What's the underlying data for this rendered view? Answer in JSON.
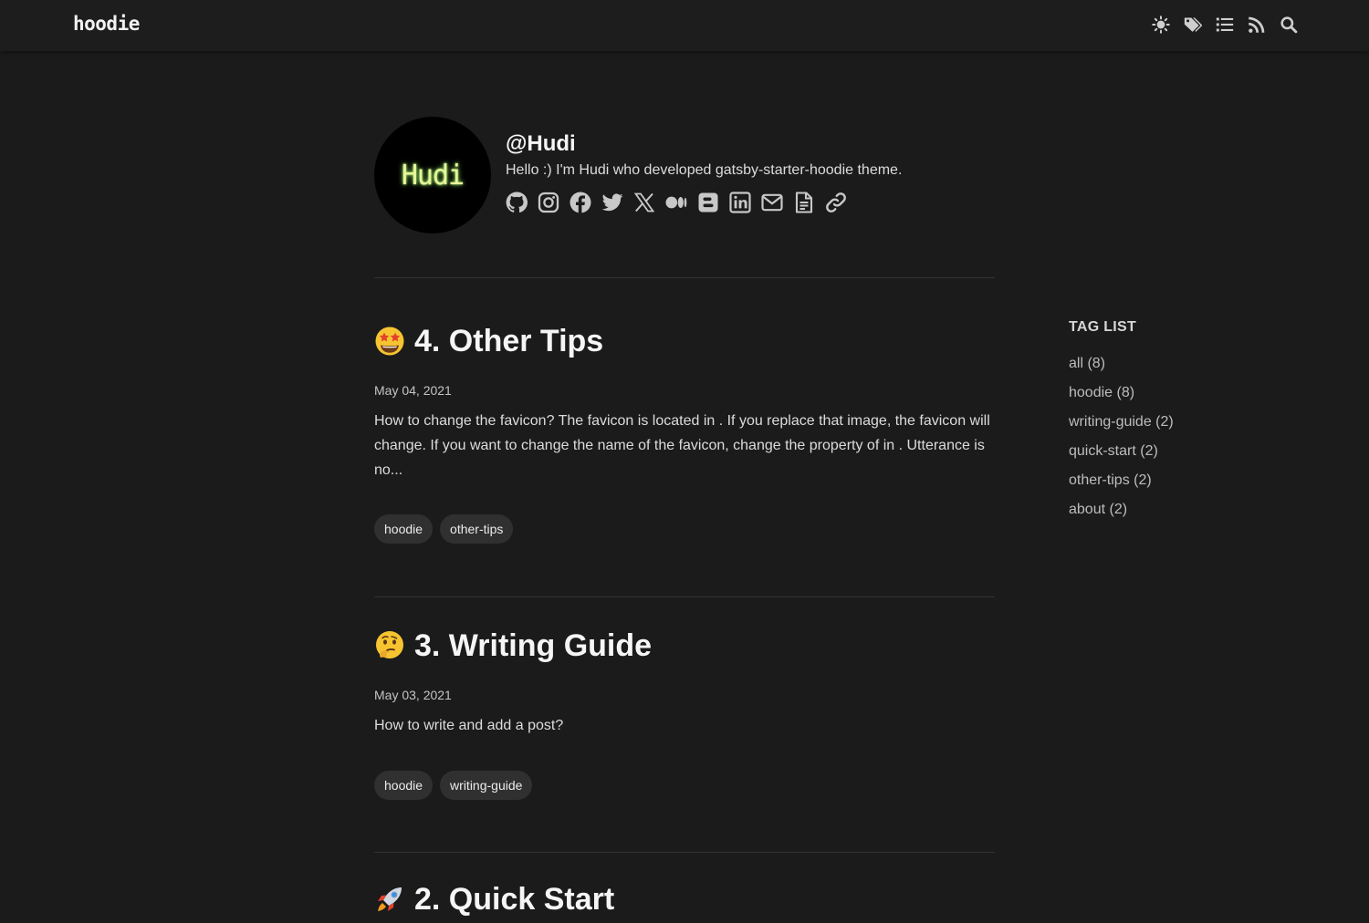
{
  "header": {
    "logo": "hoodie",
    "icons": [
      "theme-toggle-icon",
      "tags-icon",
      "post-list-icon",
      "rss-icon",
      "search-icon"
    ]
  },
  "bio": {
    "avatar_text": "Hudi",
    "name": "@Hudi",
    "description": "Hello :) I'm Hudi who developed gatsby-starter-hoodie theme.",
    "socials": [
      "github-icon",
      "instagram-icon",
      "facebook-icon",
      "twitter-icon",
      "x-icon",
      "medium-icon",
      "blogger-icon",
      "linkedin-icon",
      "email-icon",
      "resume-icon",
      "link-icon"
    ]
  },
  "posts": [
    {
      "emoji": "star-struck-emoji",
      "title": "4. Other Tips",
      "date": "May 04, 2021",
      "description": "How to change the favicon? The favicon is located in . If you replace that image, the favicon will change. If you want to change the name of the favicon, change the property of in . Utterance is no...",
      "tags": [
        "hoodie",
        "other-tips"
      ]
    },
    {
      "emoji": "thinking-face-emoji",
      "title": "3. Writing Guide",
      "date": "May 03, 2021",
      "description": "How to write and add a post?",
      "tags": [
        "hoodie",
        "writing-guide"
      ]
    },
    {
      "emoji": "rocket-emoji",
      "title": "2. Quick Start"
    }
  ],
  "taglist": {
    "title": "TAG LIST",
    "items": [
      "all (8)",
      "hoodie (8)",
      "writing-guide (2)",
      "quick-start (2)",
      "other-tips (2)",
      "about (2)"
    ]
  },
  "colors": {
    "background": "#1b1b1b",
    "header": "#1d1d1d",
    "tag_chip": "#303030",
    "text": "#ececec",
    "muted": "#bdbdbd",
    "social_icon": "#c8c8c8"
  }
}
